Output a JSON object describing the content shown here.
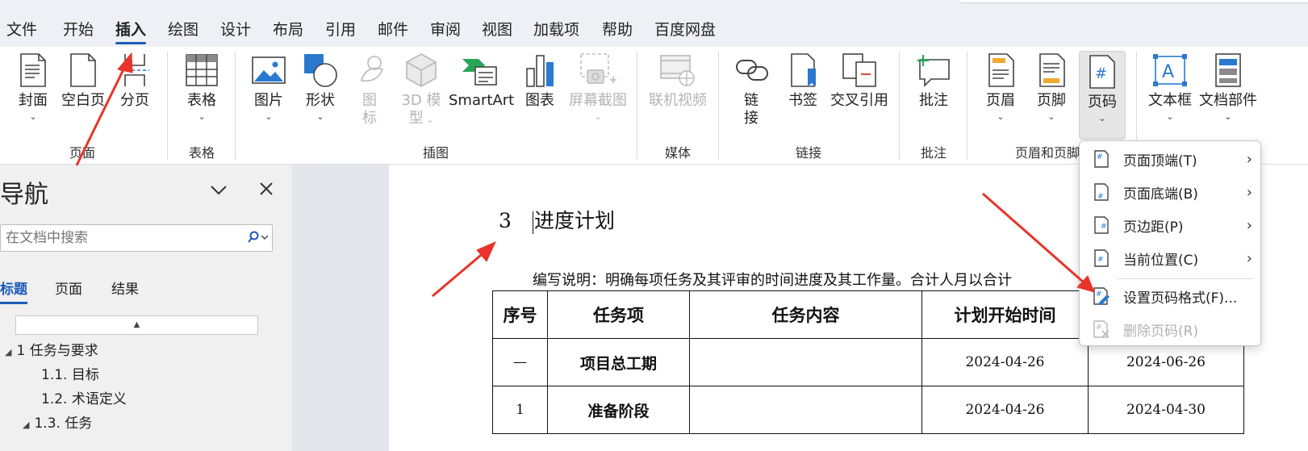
{
  "menu": {
    "tabs": [
      {
        "label": "文件"
      },
      {
        "label": "开始"
      },
      {
        "label": "插入"
      },
      {
        "label": "绘图"
      },
      {
        "label": "设计"
      },
      {
        "label": "布局"
      },
      {
        "label": "引用"
      },
      {
        "label": "邮件"
      },
      {
        "label": "审阅"
      },
      {
        "label": "视图"
      },
      {
        "label": "加载项"
      },
      {
        "label": "帮助"
      },
      {
        "label": "百度网盘"
      }
    ],
    "active_tab": "插入"
  },
  "ribbon": {
    "buttons": {
      "cover": {
        "label": "封面",
        "icon": "cover-page-icon"
      },
      "blank": {
        "label": "空白页",
        "icon": "blank-page-icon"
      },
      "pagebreak": {
        "label": "分页",
        "icon": "page-break-icon"
      },
      "table": {
        "label": "表格",
        "icon": "table-icon"
      },
      "pictures": {
        "label": "图片",
        "icon": "picture-icon"
      },
      "shapes": {
        "label": "形状",
        "icon": "shapes-icon"
      },
      "icons_line1": "图",
      "icons_line2": "标",
      "model3d_line1": "3D 模",
      "model3d_line2": "型",
      "smartart": {
        "label": "SmartArt",
        "icon": "smartart-icon"
      },
      "chart": {
        "label": "图表",
        "icon": "chart-icon"
      },
      "screenshot": {
        "label": "屏幕截图",
        "icon": "screenshot-icon"
      },
      "onlinevideo": {
        "label": "联机视频",
        "icon": "online-video-icon"
      },
      "link_line1": "链",
      "link_line2": "接",
      "bookmark": {
        "label": "书签",
        "icon": "bookmark-icon"
      },
      "crossref": {
        "label": "交叉引用",
        "icon": "cross-reference-icon"
      },
      "comment": {
        "label": "批注",
        "icon": "comment-icon"
      },
      "header": {
        "label": "页眉",
        "icon": "header-icon"
      },
      "footer": {
        "label": "页脚",
        "icon": "footer-icon"
      },
      "pagenumber": {
        "label": "页码",
        "icon": "page-number-icon"
      },
      "textbox": {
        "label": "文本框",
        "icon": "text-box-icon"
      },
      "quickparts": {
        "label": "文档部件",
        "icon": "quick-parts-icon"
      }
    },
    "groups": {
      "pages": "页面",
      "tables": "表格",
      "illustrations": "插图",
      "media": "媒体",
      "links": "链接",
      "comments": "批注",
      "headerfooter": "页眉和页脚"
    }
  },
  "nav": {
    "title": "导航",
    "search_placeholder": "在文档中搜索",
    "tabs": [
      {
        "label": "标题"
      },
      {
        "label": "页面"
      },
      {
        "label": "结果"
      }
    ],
    "tree": [
      {
        "label": "1 任务与要求"
      },
      {
        "label": "1.1. 目标"
      },
      {
        "label": "1.2. 术语定义"
      },
      {
        "label": "1.3. 任务"
      }
    ]
  },
  "document": {
    "heading_number": "3",
    "heading_text": "进度计划",
    "note": "编写说明：明确每项任务及其评审的时间进度及其工作量。合计人月以合计",
    "table": {
      "headers": [
        "序号",
        "任务项",
        "任务内容",
        "计划开始时间",
        ""
      ],
      "rows": [
        {
          "no": "—",
          "item": "项目总工期",
          "content": "",
          "start": "2024-04-26",
          "end": "2024-06-26"
        },
        {
          "no": "1",
          "item": "准备阶段",
          "content": "",
          "start": "2024-04-26",
          "end": "2024-04-30"
        }
      ]
    }
  },
  "dropdown": {
    "items": [
      {
        "label": "页面顶端(T)",
        "icon": "page-top-icon"
      },
      {
        "label": "页面底端(B)",
        "icon": "page-bottom-icon"
      },
      {
        "label": "页边距(P)",
        "icon": "page-margin-icon"
      },
      {
        "label": "当前位置(C)",
        "icon": "current-position-icon"
      },
      {
        "label": "设置页码格式(F)...",
        "icon": "format-page-number-icon"
      },
      {
        "label": "删除页码(R)",
        "icon": "remove-page-number-icon"
      }
    ]
  },
  "colors": {
    "accent": "#1e5bb8",
    "annotation_arrow": "#e8342a",
    "disabled": "#b4b4b4"
  }
}
